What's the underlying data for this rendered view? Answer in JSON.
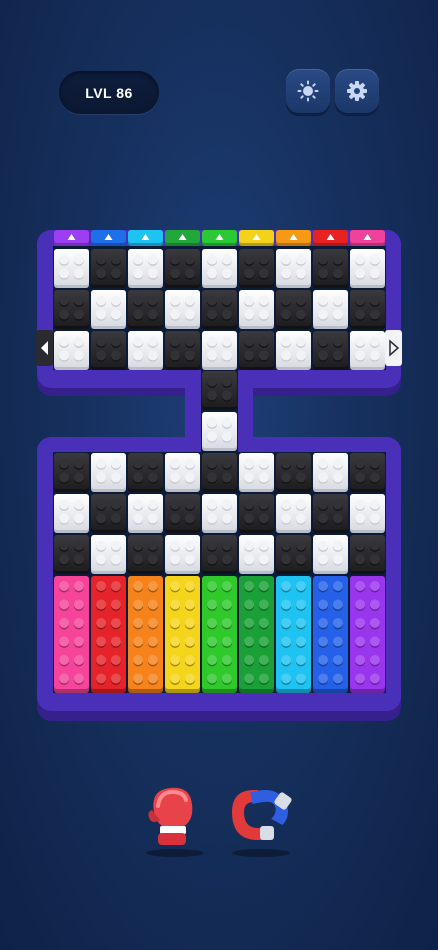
{
  "header": {
    "level_label": "LVL 86",
    "buttons": [
      {
        "name": "theme-button",
        "icon": "sun-icon"
      },
      {
        "name": "settings-button",
        "icon": "gear-icon"
      }
    ]
  },
  "board": {
    "frame_color": "#4a2fb8",
    "frame_dark": "#35208c",
    "top_indicators": [
      "#9b3ff0",
      "#1f6fe8",
      "#1ec3f2",
      "#22a83a",
      "#2ac935",
      "#f2d21a",
      "#f59a16",
      "#e82222",
      "#f0429a"
    ],
    "left_arrow": "left-arrow-icon",
    "right_arrow": "right-arrow-icon",
    "upper_grid": [
      [
        "w",
        "b",
        "w",
        "b",
        "w",
        "b",
        "w",
        "b",
        "w"
      ],
      [
        "b",
        "w",
        "b",
        "w",
        "b",
        "w",
        "b",
        "w",
        "b"
      ],
      [
        "w",
        "b",
        "w",
        "b",
        "w",
        "b",
        "w",
        "b",
        "w"
      ]
    ],
    "neck_blocks": [
      "b",
      "w"
    ],
    "lower_grid": [
      [
        "b",
        "w",
        "b",
        "w",
        "b",
        "w",
        "b",
        "w",
        "b"
      ],
      [
        "w",
        "b",
        "w",
        "b",
        "w",
        "b",
        "w",
        "b",
        "w"
      ],
      [
        "b",
        "w",
        "b",
        "w",
        "b",
        "w",
        "b",
        "w",
        "b"
      ]
    ],
    "color_columns": [
      "#f5449a",
      "#e5232a",
      "#f5821a",
      "#f5d41c",
      "#2fc92c",
      "#1aa036",
      "#1ec3f2",
      "#2461e8",
      "#9a35ee"
    ]
  },
  "powerups": [
    {
      "name": "boxing-glove-powerup",
      "icon": "boxing-glove-icon"
    },
    {
      "name": "magnet-powerup",
      "icon": "magnet-icon"
    }
  ]
}
